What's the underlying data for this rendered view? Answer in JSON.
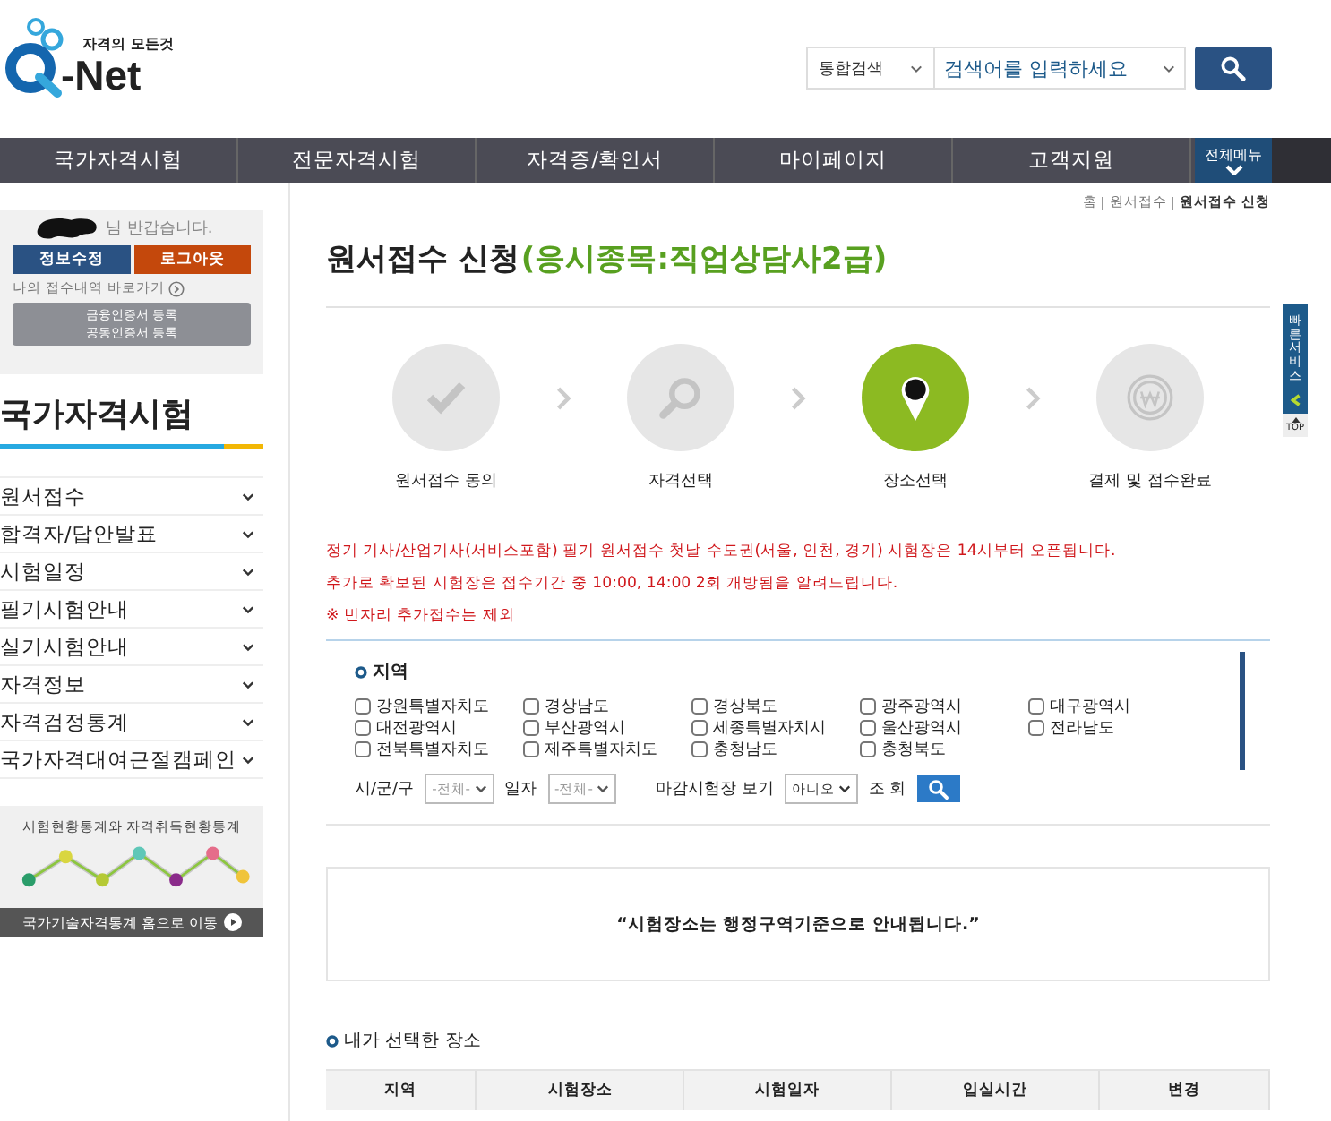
{
  "logo": {
    "tagline": "자격의 모든것",
    "name": "-Net"
  },
  "search": {
    "scope": "통합검색",
    "placeholder": "검색어를 입력하세요"
  },
  "nav": [
    {
      "label": "국가자격시험"
    },
    {
      "label": "전문자격시험"
    },
    {
      "label": "자격증/확인서"
    },
    {
      "label": "마이페이지"
    },
    {
      "label": "고객지원"
    }
  ],
  "all_menu": "전체메뉴",
  "user_box": {
    "greeting": "님 반갑습니다.",
    "edit_button": "정보수정",
    "logout_button": "로그아웃",
    "history_link": "나의 접수내역 바로가기",
    "cert_links": [
      "금융인증서 등록",
      "공동인증서 등록"
    ]
  },
  "sidebar": {
    "title": "국가자격시험",
    "items": [
      {
        "label": "원서접수",
        "expanded": false
      },
      {
        "label": "합격자/답안발표",
        "expanded": false
      },
      {
        "label": "시험일정",
        "expanded": false
      },
      {
        "label": "필기시험안내",
        "expanded": false
      },
      {
        "label": "실기시험안내",
        "expanded": false
      },
      {
        "label": "자격정보",
        "expanded": false
      },
      {
        "label": "자격검정통계",
        "expanded": false
      },
      {
        "label": "국가자격대여근절캠페인",
        "expanded": false
      }
    ]
  },
  "banner": {
    "title": "시험현황통계와 자격취득현황통계",
    "link": "국가기술자격통계 홈으로 이동"
  },
  "breadcrumb": [
    "홈",
    "원서접수",
    "원서접수 신청"
  ],
  "page_title": "원서접수 신청",
  "page_subtitle": "(응시종목:직업상담사2급)",
  "steps": [
    {
      "label": "원서접수 동의",
      "kind": "check",
      "selected": false
    },
    {
      "label": "자격선택",
      "kind": "search",
      "selected": false
    },
    {
      "label": "장소선택",
      "kind": "pin",
      "selected": true
    },
    {
      "label": "결제 및 접수완료",
      "kind": "won",
      "selected": false
    }
  ],
  "notices": [
    "정기 기사/산업기사(서비스포함) 필기 원서접수 첫날 수도권(서울, 인천, 경기) 시험장은 14시부터 오픈됩니다.",
    "추가로 확보된 시험장은 접수기간 중 10:00, 14:00 2회 개방됨을 알려드립니다.",
    "※ 빈자리 추가접수는 제외"
  ],
  "region": {
    "heading": "지역",
    "options": [
      {
        "label": "강원특별자치도",
        "checked": false
      },
      {
        "label": "경상남도",
        "checked": false
      },
      {
        "label": "경상북도",
        "checked": false
      },
      {
        "label": "광주광역시",
        "checked": false
      },
      {
        "label": "대구광역시",
        "checked": false
      },
      {
        "label": "대전광역시",
        "checked": false
      },
      {
        "label": "부산광역시",
        "checked": false
      },
      {
        "label": "세종특별자치시",
        "checked": false
      },
      {
        "label": "울산광역시",
        "checked": false
      },
      {
        "label": "전라남도",
        "checked": false
      },
      {
        "label": "전북특별자치도",
        "checked": false
      },
      {
        "label": "제주특별자치도",
        "checked": false
      },
      {
        "label": "충청남도",
        "checked": false
      },
      {
        "label": "충청북도",
        "checked": false
      }
    ]
  },
  "filters": {
    "district_label": "시/군/구",
    "district_value": "-전체-",
    "date_label": "일자",
    "date_value": "-전체-",
    "closed_label": "마감시험장 보기",
    "closed_value": "아니오",
    "query_label": "조 회"
  },
  "info_message": "“시험장소는 행정구역기준으로 안내됩니다.”",
  "selected_heading": "내가 선택한 장소",
  "table": {
    "columns": [
      "지역",
      "시험장소",
      "시험일자",
      "입실시간",
      "변경"
    ]
  },
  "quick_service": {
    "label": "빠른서비스",
    "top": "TOP"
  }
}
